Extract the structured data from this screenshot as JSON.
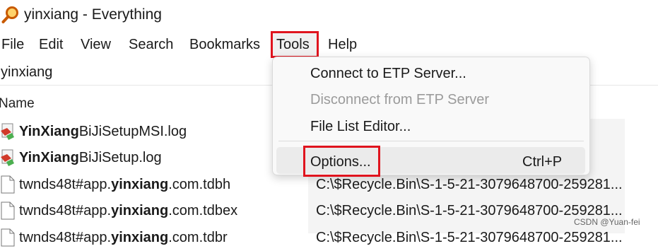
{
  "window": {
    "title": "yinxiang - Everything"
  },
  "menubar": {
    "items": [
      {
        "label": "File"
      },
      {
        "label": "Edit"
      },
      {
        "label": "View"
      },
      {
        "label": "Search"
      },
      {
        "label": "Bookmarks"
      },
      {
        "label": "Tools"
      },
      {
        "label": "Help"
      }
    ]
  },
  "search": {
    "value": "yinxiang"
  },
  "columns": {
    "name": "Name"
  },
  "rows": [
    {
      "bold": "YinXiang",
      "rest": "BiJiSetupMSI.log",
      "path": ""
    },
    {
      "bold": "YinXiang",
      "rest": "BiJiSetup.log",
      "path": ""
    },
    {
      "pre": "twnds48t#app.",
      "bold": "yinxiang",
      "rest": ".com.tdbh",
      "path": "C:\\$Recycle.Bin\\S-1-5-21-3079648700-259281..."
    },
    {
      "pre": "twnds48t#app.",
      "bold": "yinxiang",
      "rest": ".com.tdbex",
      "path": "C:\\$Recycle.Bin\\S-1-5-21-3079648700-259281..."
    },
    {
      "pre": "twnds48t#app.",
      "bold": "yinxiang",
      "rest": ".com.tdbr",
      "path": "C:\\$Recycle.Bin\\S-1-5-21-3079648700-259281..."
    }
  ],
  "tools_menu": {
    "items": [
      {
        "label": "Connect to ETP Server...",
        "enabled": true
      },
      {
        "label": "Disconnect from ETP Server",
        "enabled": false
      },
      {
        "label": "File List Editor...",
        "enabled": true
      },
      {
        "label": "Options...",
        "shortcut": "Ctrl+P",
        "enabled": true,
        "highlighted": true
      }
    ]
  },
  "watermark": "CSDN @Yuan-fei",
  "colors": {
    "highlight_box": "#e0141e",
    "disabled_text": "#9b9b9b"
  },
  "icons": {
    "app": "magnifier-icon",
    "log_file": "setup-log-icon",
    "generic_file": "document-icon"
  }
}
